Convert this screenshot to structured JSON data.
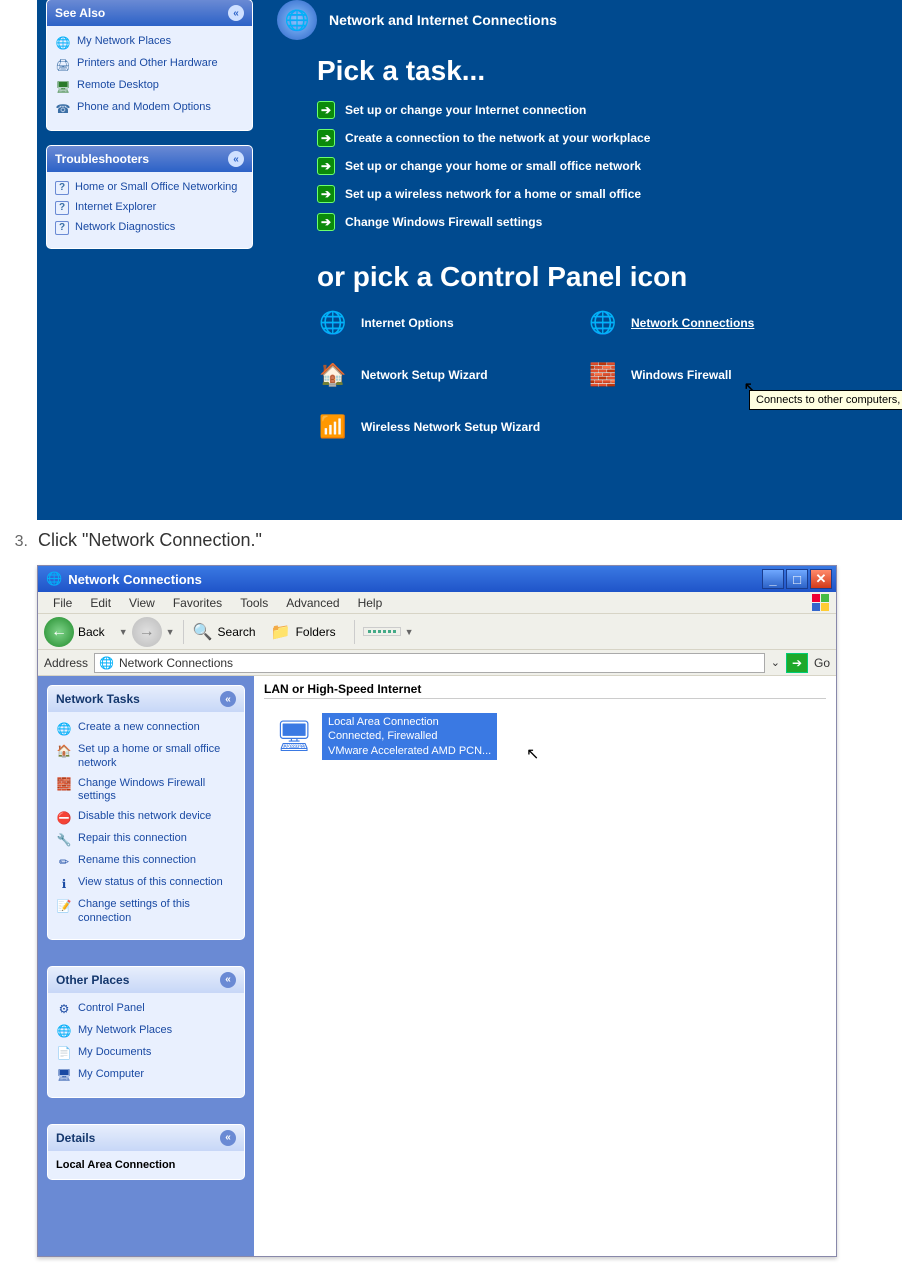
{
  "shot1": {
    "header_title": "Network and Internet Connections",
    "see_also": {
      "title": "See Also",
      "items": [
        "My Network Places",
        "Printers and Other Hardware",
        "Remote Desktop",
        "Phone and Modem Options"
      ]
    },
    "troubleshooters": {
      "title": "Troubleshooters",
      "items": [
        "Home or Small Office Networking",
        "Internet Explorer",
        "Network Diagnostics"
      ]
    },
    "pick_task": "Pick a task...",
    "tasks": [
      "Set up or change your Internet connection",
      "Create a connection to the network at your workplace",
      "Set up or change your home or small office network",
      "Set up a wireless network for a home or small office",
      "Change Windows Firewall settings"
    ],
    "or_pick": "or pick a Control Panel icon",
    "cp_icons": [
      "Internet Options",
      "Network Connections",
      "Network Setup Wizard",
      "Windows Firewall",
      "Wireless Network Setup Wizard"
    ],
    "tooltip": "Connects to other computers, netw"
  },
  "instruction": {
    "num": "3.",
    "text": "Click \"Network Connection.\""
  },
  "shot2": {
    "title": "Network Connections",
    "menus": [
      "File",
      "Edit",
      "View",
      "Favorites",
      "Tools",
      "Advanced",
      "Help"
    ],
    "toolbar": {
      "back": "Back",
      "search": "Search",
      "folders": "Folders"
    },
    "address_label": "Address",
    "address_value": "Network Connections",
    "go": "Go",
    "group_header": "LAN or High-Speed Internet",
    "connection": {
      "name": "Local Area Connection",
      "status": "Connected, Firewalled",
      "device": "VMware Accelerated AMD PCN..."
    },
    "network_tasks": {
      "title": "Network Tasks",
      "items": [
        "Create a new connection",
        "Set up a home or small office network",
        "Change Windows Firewall settings",
        "Disable this network device",
        "Repair this connection",
        "Rename this connection",
        "View status of this connection",
        "Change settings of this connection"
      ]
    },
    "other_places": {
      "title": "Other Places",
      "items": [
        "Control Panel",
        "My Network Places",
        "My Documents",
        "My Computer"
      ]
    },
    "details": {
      "title": "Details",
      "text": "Local Area Connection"
    }
  }
}
